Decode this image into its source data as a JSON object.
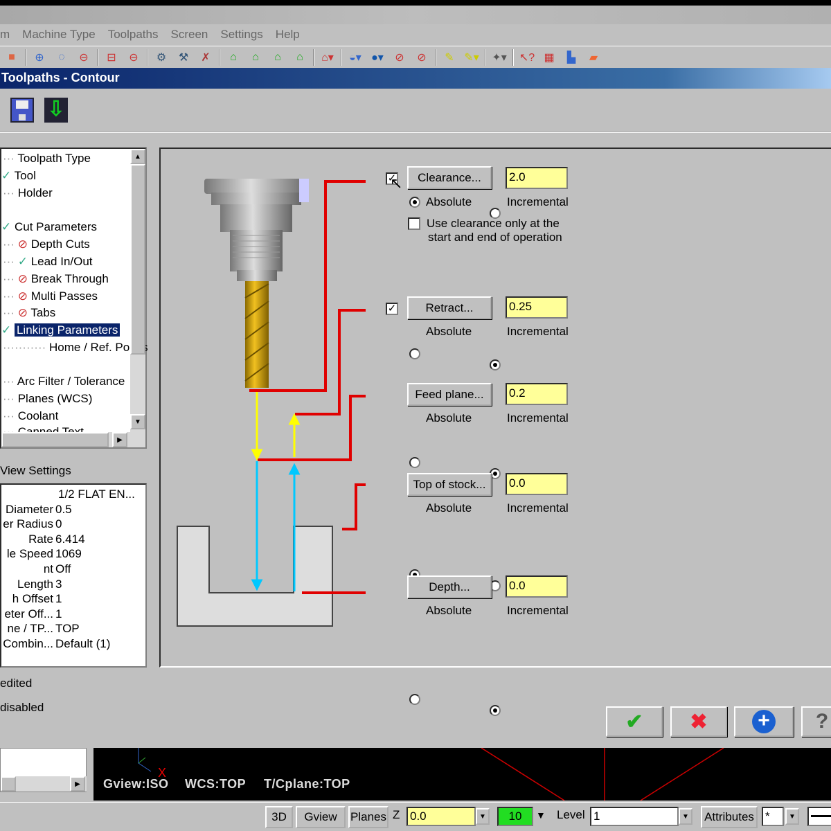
{
  "menu": [
    "m",
    "Machine Type",
    "Toolpaths",
    "Screen",
    "Settings",
    "Help"
  ],
  "dialog": {
    "title": "Toolpaths - Contour"
  },
  "tree": {
    "items": [
      {
        "label": "Toolpath Type",
        "status": "none"
      },
      {
        "label": "Tool",
        "status": "check"
      },
      {
        "label": "Holder",
        "status": "none"
      },
      {
        "label": "Cut Parameters",
        "status": "check"
      },
      {
        "label": "Depth Cuts",
        "status": "disabled"
      },
      {
        "label": "Lead In/Out",
        "status": "check"
      },
      {
        "label": "Break Through",
        "status": "disabled"
      },
      {
        "label": "Multi Passes",
        "status": "disabled"
      },
      {
        "label": "Tabs",
        "status": "disabled"
      },
      {
        "label": "Linking Parameters",
        "status": "check",
        "selected": true
      },
      {
        "label": "Home / Ref. Points",
        "status": "none"
      },
      {
        "label": "Arc Filter / Tolerance",
        "status": "none"
      },
      {
        "label": "Planes (WCS)",
        "status": "none"
      },
      {
        "label": "Coolant",
        "status": "none"
      },
      {
        "label": "Canned Text",
        "status": "none"
      }
    ]
  },
  "view_settings": {
    "label": "View Settings",
    "rows": [
      {
        "k": "",
        "v": "1/2 FLAT EN..."
      },
      {
        "k": "Diameter",
        "v": "0.5"
      },
      {
        "k": "er Radius",
        "v": "0"
      },
      {
        "k": "Rate",
        "v": "6.414"
      },
      {
        "k": "le Speed",
        "v": "1069"
      },
      {
        "k": "nt",
        "v": "Off"
      },
      {
        "k": "Length",
        "v": "3"
      },
      {
        "k": "h Offset",
        "v": "1"
      },
      {
        "k": "eter Off...",
        "v": "1"
      },
      {
        "k": "ne / TP...",
        "v": "TOP"
      },
      {
        "k": "Combin...",
        "v": "Default (1)"
      }
    ]
  },
  "legend": {
    "edited": "edited",
    "disabled": "disabled"
  },
  "params": {
    "clearance": {
      "enabled": true,
      "label": "Clearance...",
      "value": "2.0",
      "mode": "Absolute"
    },
    "clearance_only": {
      "checked": false,
      "line1": "Use clearance only at the",
      "line2": "start and end of operation"
    },
    "retract": {
      "enabled": true,
      "label": "Retract...",
      "value": "0.25",
      "mode": "Incremental"
    },
    "feed_plane": {
      "label": "Feed plane...",
      "value": "0.2",
      "mode": "Incremental"
    },
    "top_of_stock": {
      "label": "Top of stock...",
      "value": "0.0",
      "mode": "Absolute"
    },
    "depth": {
      "label": "Depth...",
      "value": "0.0",
      "mode": "Incremental"
    },
    "absolute": "Absolute",
    "incremental": "Incremental"
  },
  "graphics": {
    "gview": "Gview:ISO",
    "wcs": "WCS:TOP",
    "tcplane": "T/Cplane:TOP"
  },
  "status": {
    "b3d": "3D",
    "gview": "Gview",
    "planes": "Planes",
    "z_label": "Z",
    "z_value": "0.0",
    "color_value": "10",
    "level_label": "Level",
    "level_value": "1",
    "attributes": "Attributes",
    "point_style": "*"
  },
  "colors": {
    "caption": "#0a246a",
    "input": "#ffff99",
    "red_line": "#e00000",
    "yellow_arrow": "#ffff00",
    "cyan_arrow": "#00c8ff",
    "color_box": "#22dd22"
  }
}
